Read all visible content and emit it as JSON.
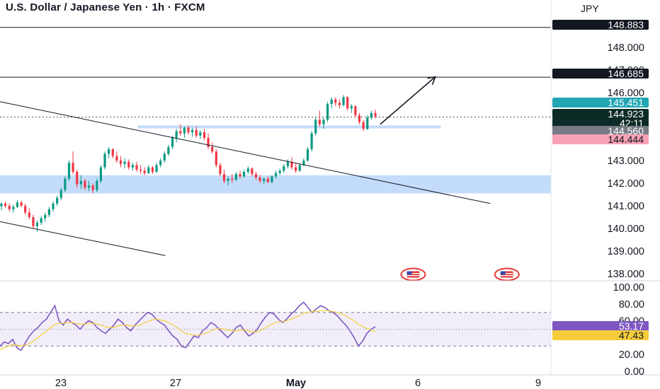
{
  "header": {
    "symbol_title": "U.S. Dollar / Japanese Yen · 1h · FXCM",
    "currency": "JPY"
  },
  "chart_data": [
    {
      "type": "candlestick",
      "title": "U.S. Dollar / Japanese Yen · 1h · FXCM",
      "x_tick_labels": [
        "23",
        "27",
        "May",
        "6",
        "9"
      ],
      "y_tick_labels": [
        "148.000",
        "147.000",
        "146.000",
        "143.000",
        "142.000",
        "141.000",
        "140.000",
        "139.000",
        "138.000"
      ],
      "ylim": [
        137.8,
        149.3
      ],
      "grid": false,
      "price_labels": [
        {
          "value": "148.883",
          "style": "dark"
        },
        {
          "value": "146.685",
          "style": "dark"
        },
        {
          "value": "145.451",
          "style": "teal"
        },
        {
          "value": "144.923",
          "style": "black"
        },
        {
          "value": "42:11",
          "style": "black"
        },
        {
          "value": "144.560",
          "style": "gray"
        },
        {
          "value": "144.444",
          "style": "pink"
        }
      ],
      "horizontal_lines": [
        148.883,
        146.685
      ],
      "last_price": 144.923,
      "zones": [
        {
          "from": 141.55,
          "to": 142.35,
          "x_from": 0,
          "x_to": 1
        },
        {
          "from": 144.42,
          "to": 144.55,
          "x_from": 0.25,
          "x_to": 0.8
        }
      ],
      "trendlines": [
        {
          "from": [
            0,
            145.6
          ],
          "to": [
            0.89,
            141.1
          ]
        },
        {
          "from": [
            0,
            140.3
          ],
          "to": [
            0.3,
            138.8
          ]
        },
        {
          "from": [
            0.69,
            144.6
          ],
          "to": [
            0.79,
            146.7
          ]
        }
      ],
      "event_markers": [
        0.75,
        0.92
      ],
      "colors": {
        "up": "#089981",
        "down": "#f23645",
        "zone": "#bcd8fb",
        "teal": "#22a6b3",
        "pink": "#f7a1b5"
      },
      "ohlc": [
        [
          140.98,
          141.15,
          140.8,
          141.1
        ],
        [
          141.1,
          141.2,
          140.9,
          141.0
        ],
        [
          141.0,
          141.1,
          140.75,
          140.85
        ],
        [
          140.85,
          141.05,
          140.7,
          140.95
        ],
        [
          140.95,
          141.25,
          140.9,
          141.15
        ],
        [
          141.15,
          141.22,
          140.95,
          141.0
        ],
        [
          141.0,
          141.1,
          140.6,
          140.7
        ],
        [
          140.7,
          140.9,
          140.4,
          140.5
        ],
        [
          140.5,
          140.6,
          140.0,
          140.1
        ],
        [
          140.1,
          140.35,
          139.85,
          140.25
        ],
        [
          140.25,
          140.55,
          140.15,
          140.45
        ],
        [
          140.45,
          140.7,
          140.3,
          140.6
        ],
        [
          140.6,
          140.95,
          140.5,
          140.85
        ],
        [
          140.85,
          141.2,
          140.75,
          141.1
        ],
        [
          141.1,
          141.45,
          141.0,
          141.35
        ],
        [
          141.35,
          141.8,
          141.25,
          141.7
        ],
        [
          141.7,
          142.3,
          141.6,
          142.2
        ],
        [
          142.2,
          143.0,
          142.1,
          142.9
        ],
        [
          142.9,
          143.4,
          142.4,
          142.5
        ],
        [
          142.5,
          142.6,
          141.8,
          141.95
        ],
        [
          141.95,
          142.35,
          141.75,
          142.1
        ],
        [
          142.1,
          142.2,
          141.7,
          141.8
        ],
        [
          141.8,
          142.1,
          141.65,
          141.9
        ],
        [
          141.9,
          142.0,
          141.55,
          141.7
        ],
        [
          141.7,
          142.2,
          141.6,
          142.1
        ],
        [
          142.1,
          142.8,
          142.0,
          142.7
        ],
        [
          142.7,
          143.4,
          142.6,
          143.3
        ],
        [
          143.3,
          143.6,
          143.1,
          143.5
        ],
        [
          143.5,
          143.55,
          143.1,
          143.2
        ],
        [
          143.2,
          143.4,
          142.9,
          143.0
        ],
        [
          143.0,
          143.2,
          142.7,
          142.85
        ],
        [
          142.85,
          143.1,
          142.65,
          142.95
        ],
        [
          142.95,
          143.05,
          142.6,
          142.7
        ],
        [
          142.7,
          142.9,
          142.55,
          142.8
        ],
        [
          142.8,
          142.95,
          142.5,
          142.6
        ],
        [
          142.6,
          142.8,
          142.4,
          142.55
        ],
        [
          142.55,
          142.7,
          142.35,
          142.45
        ],
        [
          142.45,
          142.8,
          142.4,
          142.7
        ],
        [
          142.7,
          142.75,
          142.4,
          142.5
        ],
        [
          142.5,
          142.9,
          142.45,
          142.8
        ],
        [
          142.8,
          143.1,
          142.7,
          143.0
        ],
        [
          143.0,
          143.4,
          142.9,
          143.3
        ],
        [
          143.3,
          143.7,
          143.2,
          143.6
        ],
        [
          143.6,
          144.1,
          143.5,
          144.0
        ],
        [
          144.0,
          144.4,
          143.8,
          144.3
        ],
        [
          144.3,
          144.6,
          144.1,
          144.2
        ],
        [
          144.2,
          144.5,
          144.0,
          144.45
        ],
        [
          144.45,
          144.55,
          144.15,
          144.25
        ],
        [
          144.25,
          144.45,
          144.05,
          144.35
        ],
        [
          144.35,
          144.5,
          144.0,
          144.1
        ],
        [
          144.1,
          144.35,
          143.95,
          144.25
        ],
        [
          144.25,
          144.4,
          143.9,
          144.0
        ],
        [
          144.0,
          144.2,
          143.5,
          143.6
        ],
        [
          143.6,
          143.8,
          143.3,
          143.4
        ],
        [
          143.4,
          143.5,
          142.7,
          142.8
        ],
        [
          142.8,
          142.9,
          142.3,
          142.4
        ],
        [
          142.4,
          142.6,
          142.0,
          142.1
        ],
        [
          142.1,
          142.3,
          141.9,
          142.2
        ],
        [
          142.2,
          142.4,
          142.0,
          142.15
        ],
        [
          142.15,
          142.5,
          142.1,
          142.4
        ],
        [
          142.4,
          142.55,
          142.2,
          142.3
        ],
        [
          142.3,
          142.6,
          142.25,
          142.5
        ],
        [
          142.5,
          142.75,
          142.4,
          142.65
        ],
        [
          142.65,
          142.7,
          142.3,
          142.4
        ],
        [
          142.4,
          142.5,
          142.15,
          142.25
        ],
        [
          142.25,
          142.35,
          142.0,
          142.1
        ],
        [
          142.1,
          142.25,
          141.95,
          142.2
        ],
        [
          142.2,
          142.3,
          142.0,
          142.05
        ],
        [
          142.05,
          142.35,
          142.0,
          142.3
        ],
        [
          142.3,
          142.55,
          142.2,
          142.45
        ],
        [
          142.45,
          142.65,
          142.35,
          142.55
        ],
        [
          142.55,
          142.85,
          142.45,
          142.75
        ],
        [
          142.75,
          143.05,
          142.65,
          142.95
        ],
        [
          142.95,
          143.15,
          142.6,
          142.7
        ],
        [
          142.7,
          142.9,
          142.45,
          142.55
        ],
        [
          142.55,
          142.85,
          142.5,
          142.8
        ],
        [
          142.8,
          143.1,
          142.75,
          143.0
        ],
        [
          143.0,
          143.6,
          142.95,
          143.5
        ],
        [
          143.5,
          144.3,
          143.4,
          144.2
        ],
        [
          144.2,
          144.9,
          144.1,
          144.8
        ],
        [
          144.8,
          145.2,
          144.5,
          144.6
        ],
        [
          144.6,
          144.9,
          144.4,
          144.8
        ],
        [
          144.8,
          145.6,
          144.7,
          145.5
        ],
        [
          145.5,
          145.8,
          145.3,
          145.7
        ],
        [
          145.7,
          145.8,
          145.4,
          145.55
        ],
        [
          145.55,
          145.7,
          145.3,
          145.45
        ],
        [
          145.45,
          145.9,
          145.4,
          145.8
        ],
        [
          145.8,
          145.85,
          145.2,
          145.3
        ],
        [
          145.3,
          145.5,
          145.1,
          145.4
        ],
        [
          145.4,
          145.45,
          144.9,
          145.0
        ],
        [
          145.0,
          145.1,
          144.6,
          144.7
        ],
        [
          144.7,
          144.8,
          144.3,
          144.4
        ],
        [
          144.4,
          145.0,
          144.35,
          144.9
        ],
        [
          144.9,
          145.2,
          144.8,
          145.1
        ],
        [
          145.1,
          145.25,
          144.85,
          144.95
        ]
      ]
    },
    {
      "type": "line",
      "title": "",
      "y_tick_labels": [
        "100.00",
        "80.00",
        "60.00",
        "20.00",
        "0.00"
      ],
      "ylim": [
        -3,
        104
      ],
      "band": [
        30,
        70
      ],
      "value_labels": [
        {
          "value": "53.17",
          "color": "#7e57c2"
        },
        {
          "value": "47.43",
          "color": "#f5cd3b"
        }
      ],
      "series": [
        {
          "color": "#7e57c2",
          "values": [
            30,
            35,
            33,
            38,
            28,
            25,
            34,
            42,
            48,
            52,
            58,
            62,
            70,
            78,
            60,
            55,
            62,
            58,
            55,
            50,
            56,
            60,
            58,
            52,
            48,
            45,
            50,
            55,
            62,
            58,
            52,
            48,
            55,
            60,
            65,
            70,
            68,
            62,
            58,
            55,
            48,
            42,
            38,
            30,
            28,
            35,
            42,
            40,
            48,
            52,
            58,
            55,
            50,
            45,
            40,
            45,
            52,
            55,
            48,
            42,
            45,
            50,
            58,
            65,
            70,
            68,
            62,
            58,
            62,
            68,
            72,
            78,
            82,
            76,
            70,
            74,
            78,
            76,
            72,
            70,
            66,
            60,
            55,
            48,
            40,
            30,
            36,
            45,
            50,
            53
          ]
        },
        {
          "color": "#f5cd3b",
          "values": [
            26,
            28,
            30,
            32,
            31,
            30,
            31,
            33,
            36,
            40,
            44,
            48,
            52,
            56,
            57,
            57,
            58,
            58,
            57,
            56,
            56,
            57,
            57,
            56,
            55,
            53,
            52,
            52,
            54,
            55,
            55,
            54,
            54,
            55,
            57,
            59,
            61,
            62,
            61,
            60,
            58,
            55,
            52,
            48,
            45,
            44,
            43,
            43,
            44,
            46,
            48,
            50,
            51,
            50,
            49,
            48,
            48,
            49,
            49,
            48,
            47,
            47,
            49,
            52,
            55,
            57,
            59,
            59,
            60,
            62,
            64,
            66,
            69,
            70,
            71,
            71,
            72,
            72,
            72,
            71,
            70,
            68,
            66,
            63,
            60,
            56,
            53,
            51,
            49,
            47
          ]
        }
      ]
    }
  ]
}
